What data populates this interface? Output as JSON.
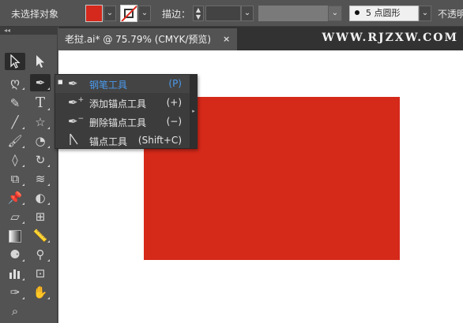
{
  "control_bar": {
    "selection_status": "未选择对象",
    "stroke_label": "描边：",
    "brush_value": "5 点圆形",
    "opacity_label": "不透明"
  },
  "document_tab": {
    "title": "老挝.ai* @ 75.79% (CMYK/预览)",
    "close": "×"
  },
  "watermark": "WWW.RJZXW.COM",
  "flyout": {
    "items": [
      {
        "label": "钢笔工具",
        "shortcut": "(P)"
      },
      {
        "label": "添加锚点工具",
        "shortcut": "(+)"
      },
      {
        "label": "删除锚点工具",
        "shortcut": "(−)"
      },
      {
        "label": "锚点工具",
        "shortcut": "(Shift+C)"
      }
    ]
  },
  "colors": {
    "fill": "#d4291c",
    "selected_text": "#4a9bef",
    "canvas_object": "#d5291a"
  },
  "toolbar": {
    "tools": [
      "selection-tool",
      "direct-selection-tool",
      "lasso-tool",
      "pen-tool",
      "curvature-tool",
      "type-tool",
      "line-tool",
      "star-tool",
      "paintbrush-tool",
      "blob-brush-tool",
      "eraser-tool",
      "rotate-tool",
      "scale-tool",
      "warp-tool",
      "pin-tool",
      "shape-builder-tool",
      "perspective-tool",
      "mesh-tool",
      "gradient-tool",
      "eyedropper-tool",
      "blend-tool",
      "eyedropper-alt-tool",
      "column-graph-tool",
      "artboard-tool",
      "slice-tool",
      "hand-tool",
      "zoom-tool"
    ]
  }
}
